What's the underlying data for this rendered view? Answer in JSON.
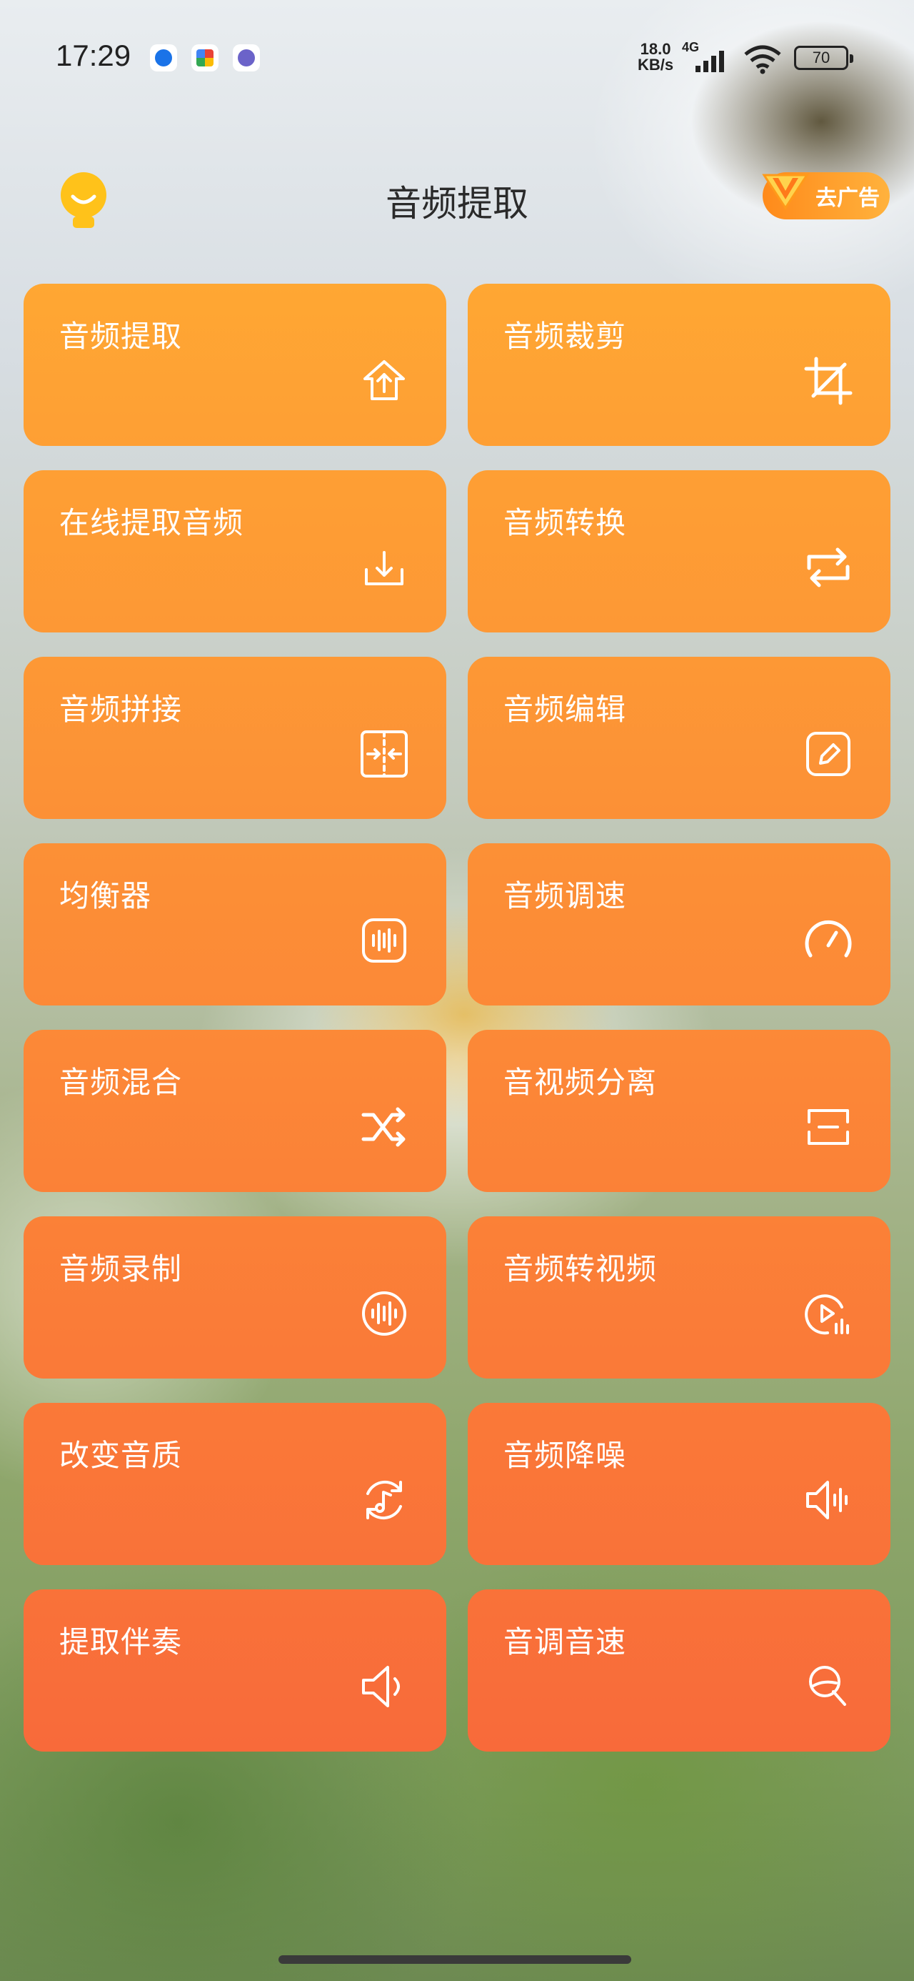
{
  "status_bar": {
    "time": "17:29",
    "net_speed_value": "18.0",
    "net_speed_unit": "KB/s",
    "net_type": "4G",
    "battery": "70"
  },
  "header": {
    "title": "音频提取",
    "ad_button_label": "去广告"
  },
  "colors": {
    "card_top": "#ffa733",
    "card_bottom": "#f86a3a",
    "text_white": "#ffffff"
  },
  "cards": [
    {
      "label": "音频提取",
      "icon": "upload-home-icon"
    },
    {
      "label": "音频裁剪",
      "icon": "crop-icon"
    },
    {
      "label": "在线提取音频",
      "icon": "download-icon"
    },
    {
      "label": "音频转换",
      "icon": "repeat-icon"
    },
    {
      "label": "音频拼接",
      "icon": "merge-icon"
    },
    {
      "label": "音频编辑",
      "icon": "edit-icon"
    },
    {
      "label": "均衡器",
      "icon": "equalizer-icon"
    },
    {
      "label": "音频调速",
      "icon": "speedometer-icon"
    },
    {
      "label": "音频混合",
      "icon": "shuffle-icon"
    },
    {
      "label": "音视频分离",
      "icon": "separate-icon"
    },
    {
      "label": "音频录制",
      "icon": "waveform-icon"
    },
    {
      "label": "音频转视频",
      "icon": "play-audio-icon"
    },
    {
      "label": "改变音质",
      "icon": "music-cycle-icon"
    },
    {
      "label": "音频降噪",
      "icon": "speaker-wave-icon"
    },
    {
      "label": "提取伴奏",
      "icon": "speaker-icon"
    },
    {
      "label": "音调音速",
      "icon": "tone-icon"
    }
  ]
}
